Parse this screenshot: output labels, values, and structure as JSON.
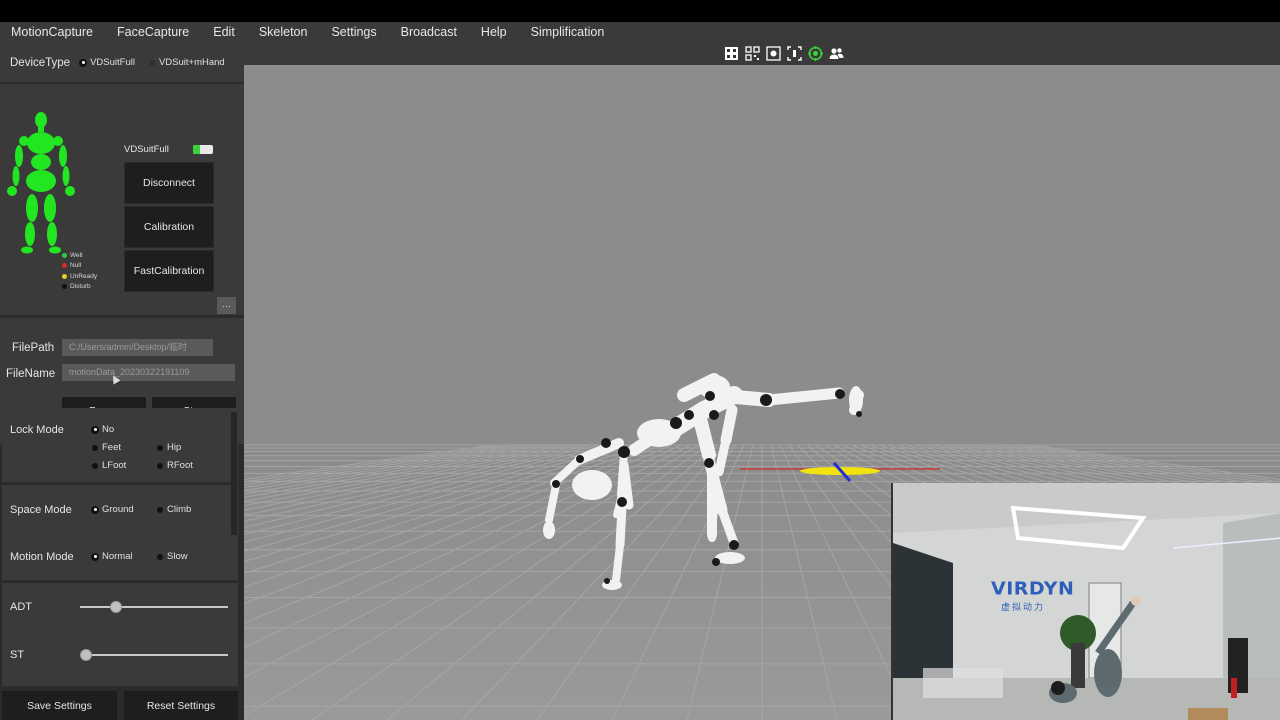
{
  "menu": [
    "MotionCapture",
    "FaceCapture",
    "Edit",
    "Skeleton",
    "Settings",
    "Broadcast",
    "Help",
    "Simplification"
  ],
  "device_type": {
    "label": "DeviceType",
    "options": [
      "VDSuitFull",
      "VDSuit+mHand"
    ],
    "selected": "VDSuitFull"
  },
  "device": {
    "suit_name": "VDSuitFull",
    "battery_level": 0.35,
    "buttons": [
      "Disconnect",
      "Calibration",
      "FastCalibration"
    ],
    "legend": [
      {
        "label": "Well",
        "color": "#2ecc40"
      },
      {
        "label": "Null",
        "color": "#d62d2d"
      },
      {
        "label": "UnReady",
        "color": "#e6d21a"
      },
      {
        "label": "Disturb",
        "color": "#111111"
      }
    ],
    "status_color": "#22e622"
  },
  "file": {
    "path_label": "FilePath",
    "path_value": "C:/Users/admin/Desktop/临时",
    "browse_label": "···",
    "name_label": "FileName",
    "name_value": "motionData_20230322191109",
    "pause_label": "Pause",
    "stop_label": "Stop"
  },
  "lock_mode": {
    "label": "Lock Mode",
    "options": [
      "No",
      "Feet",
      "Hip",
      "LFoot",
      "RFoot"
    ],
    "selected": "No"
  },
  "space_mode": {
    "label": "Space Mode",
    "options": [
      "Ground",
      "Climb"
    ],
    "selected": "Ground"
  },
  "motion_mode": {
    "label": "Motion Mode",
    "options": [
      "Normal",
      "Slow"
    ],
    "selected": "Normal"
  },
  "sliders": {
    "adt": {
      "label": "ADT",
      "value": 0.22
    },
    "st": {
      "label": "ST",
      "value": 0.0
    }
  },
  "bottom": {
    "save_label": "Save Settings",
    "reset_label": "Reset Settings"
  },
  "toolbar_icons": [
    "fullscreen-icon",
    "qr-grid-icon",
    "camera-capture-icon",
    "fit-view-icon",
    "target-icon",
    "users-icon"
  ],
  "camera": {
    "brand": "VIRDYN",
    "brand_sub": "虚拟动力"
  }
}
